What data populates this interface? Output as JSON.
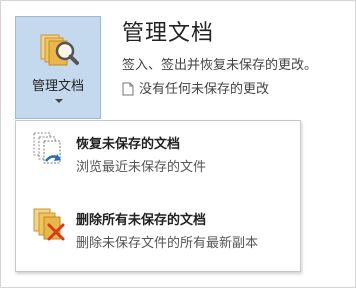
{
  "manage": {
    "button_label": "管理文档",
    "title": "管理文档",
    "description": "签入、签出并恢复未保存的更改。",
    "status": "没有任何未保存的更改"
  },
  "menu": {
    "items": [
      {
        "title": "恢复未保存的文档",
        "subtitle": "浏览最近未保存的文件",
        "icon": "recover-documents-icon"
      },
      {
        "title": "删除所有未保存的文档",
        "subtitle": "删除未保存文件的所有最新副本",
        "icon": "delete-documents-icon"
      }
    ]
  },
  "colors": {
    "button_bg": "#c5d9ee",
    "button_border": "#9db9d8",
    "folder": "#e8b64a",
    "delete_x": "#d83b1c",
    "recover_arrow": "#2b6cb5"
  }
}
